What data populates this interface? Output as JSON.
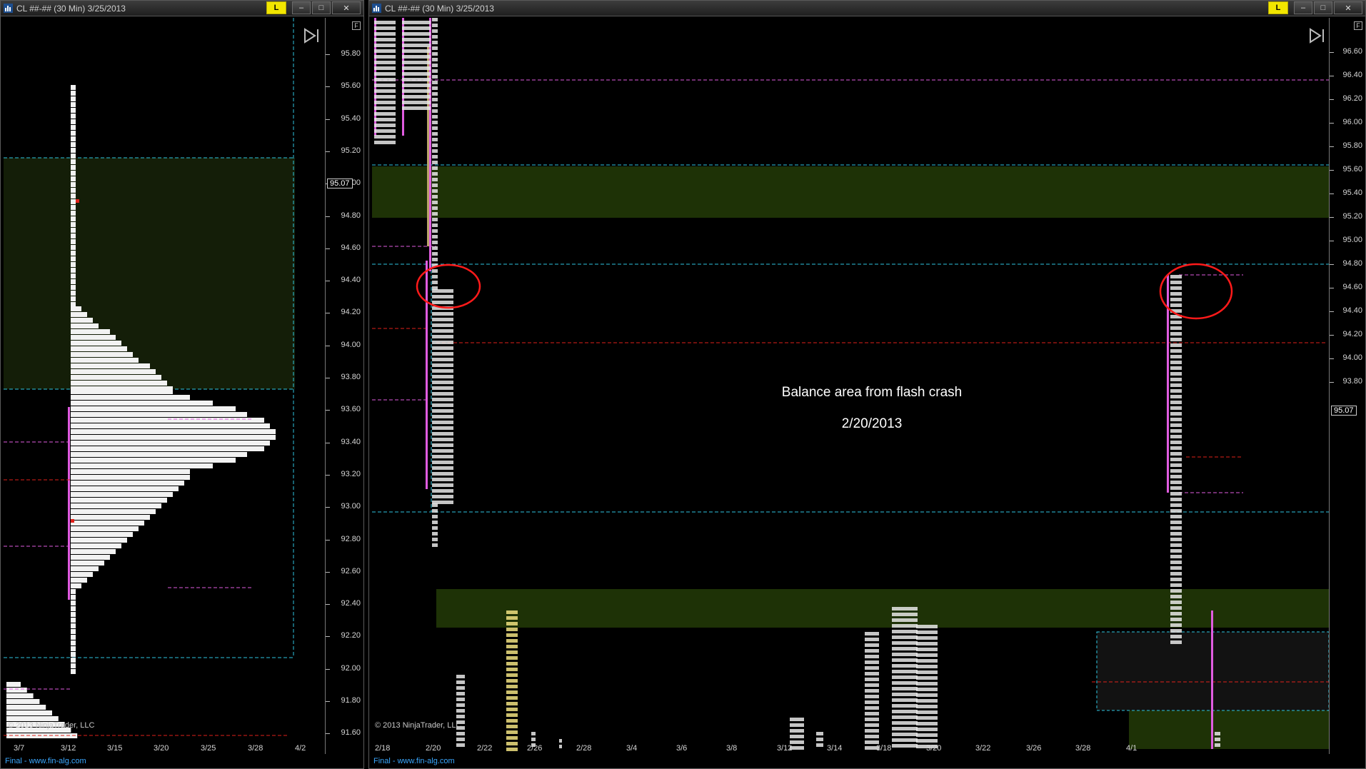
{
  "colors": {
    "background": "#000000",
    "balance_green": "#1e3206",
    "value_area_cyan": "#2ec5e0",
    "poc_red": "#e0211a",
    "magenta": "#e05ce0",
    "profile_white": "#f2f2f2",
    "annotation_circle": "#ff1a1a",
    "link_button": "#f2e600",
    "footer_link": "#3aa8ff"
  },
  "left_window": {
    "title": "CL ##-## (30 Min)  3/25/2013",
    "link_label": "L",
    "minimize": "–",
    "maximize": "□",
    "close": "✕",
    "f_button": "F",
    "price_axis": [
      "95.80",
      "95.60",
      "95.40",
      "95.20",
      "95.00",
      "94.80",
      "94.60",
      "94.40",
      "94.20",
      "94.00",
      "93.80",
      "93.60",
      "93.40",
      "93.20",
      "93.00",
      "92.80",
      "92.60",
      "92.40",
      "92.20",
      "92.00",
      "91.80",
      "91.60"
    ],
    "current_price": "95.07",
    "date_axis": [
      "3/7",
      "3/12",
      "3/15",
      "3/20",
      "3/25",
      "3/28",
      "4/2"
    ],
    "copyright": "© 2013 NinjaTrader, LLC",
    "footer": "Final - www.fin-alg.com"
  },
  "right_window": {
    "title": "CL ##-## (30 Min)  3/25/2013",
    "link_label": "L",
    "minimize": "–",
    "maximize": "□",
    "close": "✕",
    "f_button": "F",
    "price_axis": [
      "96.60",
      "96.40",
      "96.20",
      "96.00",
      "95.80",
      "95.60",
      "95.40",
      "95.20",
      "95.00",
      "94.80",
      "94.60",
      "94.40",
      "94.20",
      "94.00",
      "93.80"
    ],
    "current_price": "95.07",
    "date_axis": [
      "2/18",
      "2/20",
      "2/22",
      "2/26",
      "2/28",
      "3/4",
      "3/6",
      "3/8",
      "3/12",
      "3/14",
      "3/18",
      "3/20",
      "3/22",
      "3/26",
      "3/28",
      "4/1"
    ],
    "annotation_title": "Balance area from flash crash",
    "annotation_date": "2/20/2013",
    "copyright": "© 2013 NinjaTrader, LLC",
    "footer": "Final - www.fin-alg.com"
  }
}
